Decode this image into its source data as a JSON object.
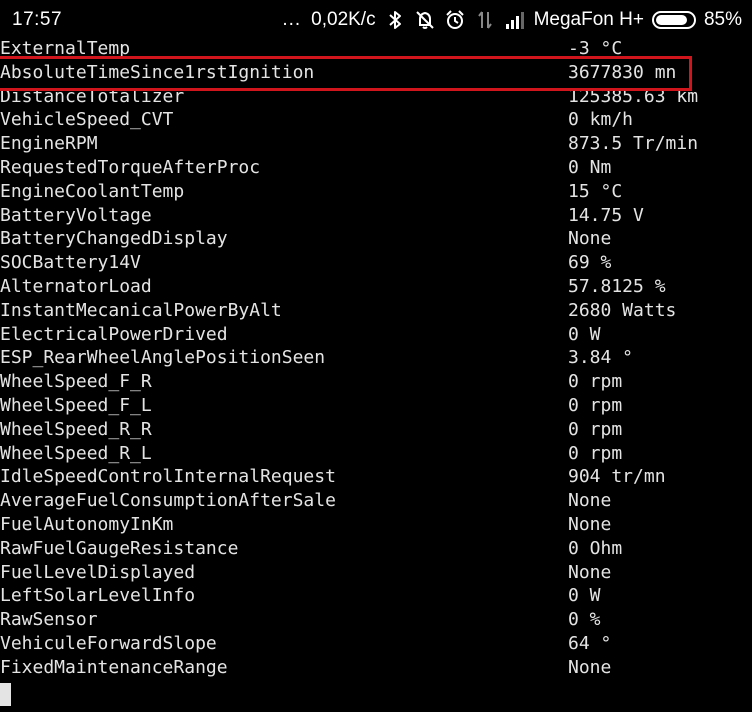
{
  "status_bar": {
    "time": "17:57",
    "dots": "...",
    "network_speed": "0,02K/c",
    "carrier": "MegaFon H+",
    "battery_percent": "85%",
    "battery_level": 0.85,
    "icons": [
      "bluetooth-icon",
      "mute-icon",
      "alarm-icon",
      "data-transfer-icon",
      "signal-icon",
      "battery-icon"
    ]
  },
  "terminal": {
    "rows": [
      {
        "key": "ExternalTemp",
        "value": "-3 °C"
      },
      {
        "key": "AbsoluteTimeSince1rstIgnition",
        "value": "3677830 mn"
      },
      {
        "key": "DistanceTotalizer",
        "value": "125385.63 km"
      },
      {
        "key": "VehicleSpeed_CVT",
        "value": "0 km/h"
      },
      {
        "key": "EngineRPM",
        "value": "873.5 Tr/min"
      },
      {
        "key": "RequestedTorqueAfterProc",
        "value": "0 Nm"
      },
      {
        "key": "EngineCoolantTemp",
        "value": "15 °C"
      },
      {
        "key": "BatteryVoltage",
        "value": "14.75 V"
      },
      {
        "key": "BatteryChangedDisplay",
        "value": "None"
      },
      {
        "key": "SOCBattery14V",
        "value": "69 %"
      },
      {
        "key": "AlternatorLoad",
        "value": "57.8125 %"
      },
      {
        "key": "InstantMecanicalPowerByAlt",
        "value": "2680 Watts"
      },
      {
        "key": "ElectricalPowerDrived",
        "value": "0 W"
      },
      {
        "key": "ESP_RearWheelAnglePositionSeen",
        "value": "3.84 °"
      },
      {
        "key": "WheelSpeed_F_R",
        "value": "0 rpm"
      },
      {
        "key": "WheelSpeed_F_L",
        "value": "0 rpm"
      },
      {
        "key": "WheelSpeed_R_R",
        "value": "0 rpm"
      },
      {
        "key": "WheelSpeed_R_L",
        "value": "0 rpm"
      },
      {
        "key": "IdleSpeedControlInternalRequest",
        "value": "904 tr/mn"
      },
      {
        "key": "AverageFuelConsumptionAfterSale",
        "value": "None"
      },
      {
        "key": "FuelAutonomyInKm",
        "value": "None"
      },
      {
        "key": "RawFuelGaugeResistance",
        "value": "0 Ohm"
      },
      {
        "key": "FuelLevelDisplayed",
        "value": "None"
      },
      {
        "key": "LeftSolarLevelInfo",
        "value": "0 W"
      },
      {
        "key": "RawSensor",
        "value": "0 %"
      },
      {
        "key": "VehiculeForwardSlope",
        "value": "64 °"
      },
      {
        "key": "FixedMaintenanceRange",
        "value": "None"
      }
    ]
  },
  "colors": {
    "background": "#000000",
    "text": "#e4e4e4",
    "highlight": "#d0161c"
  }
}
